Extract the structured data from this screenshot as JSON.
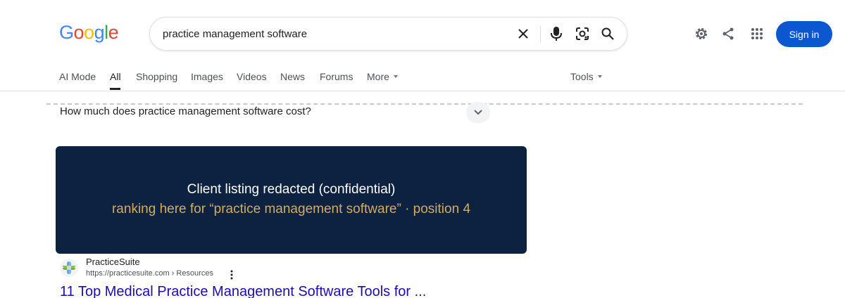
{
  "logo": {
    "letters": [
      "G",
      "o",
      "o",
      "g",
      "l",
      "e"
    ],
    "colors": [
      "#4285f4",
      "#ea4335",
      "#fbbc05",
      "#4285f4",
      "#34a853",
      "#ea4335"
    ]
  },
  "search": {
    "value": "practice management software"
  },
  "header": {
    "sign_in_label": "Sign in"
  },
  "tabs": [
    {
      "label": "AI Mode"
    },
    {
      "label": "All",
      "active": true
    },
    {
      "label": "Shopping"
    },
    {
      "label": "Images"
    },
    {
      "label": "Videos"
    },
    {
      "label": "News"
    },
    {
      "label": "Forums"
    },
    {
      "label": "More"
    }
  ],
  "tools_label": "Tools",
  "faq": {
    "question": "How much does practice management software cost?"
  },
  "redaction": {
    "line1": "Client listing redacted (confidential)",
    "line2": "ranking here for “practice management software” · position 4",
    "background": "#0d2240",
    "accent": "#d1ad5e"
  },
  "result": {
    "site_name": "PracticeSuite",
    "url": "https://practicesuite.com › Resources",
    "title": "11 Top Medical Practice Management Software Tools for ..."
  },
  "icons": [
    "clear-icon",
    "microphone-icon",
    "lens-icon",
    "search-icon",
    "settings-icon",
    "share-icon",
    "apps-grid-icon",
    "more-vert-icon",
    "chevron-down-icon"
  ],
  "colors": {
    "link": "#1a0dab",
    "sign_in": "#0b57d0"
  }
}
